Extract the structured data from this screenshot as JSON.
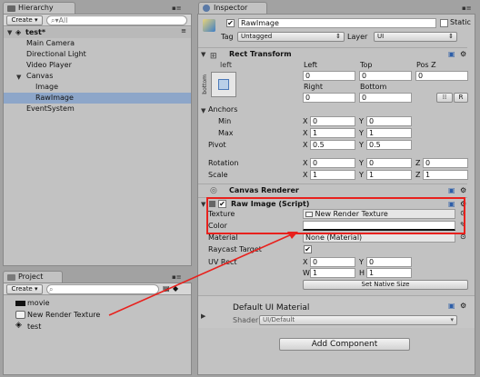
{
  "hierarchy": {
    "tab_label": "Hierarchy",
    "create_label": "Create",
    "search_placeholder": "All",
    "scene_name": "test*",
    "items": [
      "Main Camera",
      "Directional Light",
      "Video Player",
      "Canvas",
      "Image",
      "RawImage",
      "EventSystem"
    ]
  },
  "project": {
    "tab_label": "Project",
    "create_label": "Create",
    "items": [
      "movie",
      "New Render Texture",
      "test"
    ]
  },
  "inspector": {
    "tab_label": "Inspector",
    "object_name": "RawImage",
    "static_label": "Static",
    "tag_label": "Tag",
    "tag_value": "Untagged",
    "layer_label": "Layer",
    "layer_value": "UI",
    "rect_transform": {
      "title": "Rect Transform",
      "stretch_left": "left",
      "stretch_bottom": "bottom",
      "col_left": "Left",
      "col_top": "Top",
      "col_posz": "Pos Z",
      "left": "0",
      "top": "0",
      "posz": "0",
      "col_right": "Right",
      "col_bottom": "Bottom",
      "right": "0",
      "bottom": "0",
      "r_btn": "R",
      "anchors_label": "Anchors",
      "min_label": "Min",
      "min_x": "0",
      "min_y": "0",
      "max_label": "Max",
      "max_x": "1",
      "max_y": "1",
      "pivot_label": "Pivot",
      "pivot_x": "0.5",
      "pivot_y": "0.5",
      "rotation_label": "Rotation",
      "rot_x": "0",
      "rot_y": "0",
      "rot_z": "0",
      "scale_label": "Scale",
      "scale_x": "1",
      "scale_y": "1",
      "scale_z": "1",
      "x": "X",
      "y": "Y",
      "z": "Z"
    },
    "canvas_renderer": {
      "title": "Canvas Renderer"
    },
    "raw_image": {
      "title": "Raw Image (Script)",
      "texture_label": "Texture",
      "texture_value": "New Render Texture",
      "color_label": "Color",
      "material_label": "Material",
      "material_value": "None (Material)",
      "raycast_label": "Raycast Target",
      "uvrect_label": "UV Rect",
      "uv_x": "0",
      "uv_y": "0",
      "uv_w": "1",
      "uv_h": "1",
      "x": "X",
      "y": "Y",
      "w": "W",
      "h": "H",
      "native_size_btn": "Set Native Size"
    },
    "material": {
      "name": "Default UI Material",
      "shader_label": "Shader",
      "shader_value": "UI/Default"
    },
    "add_component_label": "Add Component"
  },
  "colors": {
    "highlight_red": "#e8211d",
    "selection": "#8da6c9"
  }
}
